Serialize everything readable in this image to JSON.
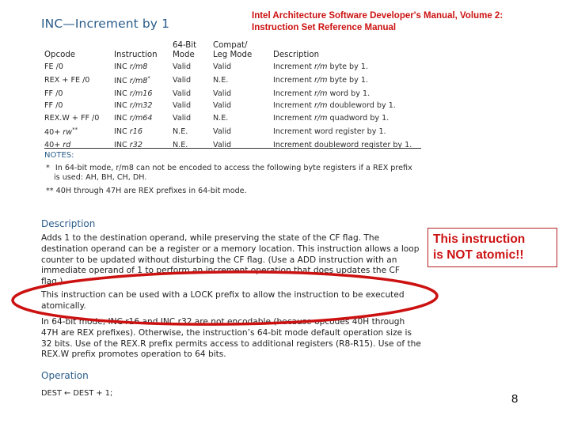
{
  "header": {
    "title": "INC—Increment by 1",
    "source_line1": "Intel Architecture Software Developer's Manual, Volume 2:",
    "source_line2": "Instruction Set Reference Manual"
  },
  "opcode_table": {
    "columns": [
      "Opcode",
      "Instruction",
      "64-Bit Mode",
      "Compat/ Leg Mode",
      "Description"
    ],
    "column_lines": [
      [
        "",
        "Opcode"
      ],
      [
        "",
        "Instruction"
      ],
      [
        "64-Bit",
        "Mode"
      ],
      [
        "Compat/",
        "Leg Mode"
      ],
      [
        "",
        "Description"
      ]
    ],
    "rows": [
      {
        "opcode": "FE /0",
        "instr_op": "INC",
        "instr_arg": "r/m8",
        "instr_sup": "",
        "mode64": "Valid",
        "compat": "Valid",
        "desc_pre": "Increment ",
        "desc_it": "r/m",
        "desc_post": " byte by 1."
      },
      {
        "opcode": "REX + FE /0",
        "instr_op": "INC",
        "instr_arg": "r/m8",
        "instr_sup": "*",
        "mode64": "Valid",
        "compat": "N.E.",
        "desc_pre": "Increment ",
        "desc_it": "r/m",
        "desc_post": " byte by 1."
      },
      {
        "opcode": "FF /0",
        "instr_op": "INC",
        "instr_arg": "r/m16",
        "instr_sup": "",
        "mode64": "Valid",
        "compat": "Valid",
        "desc_pre": "Increment ",
        "desc_it": "r/m",
        "desc_post": " word by 1."
      },
      {
        "opcode": "FF /0",
        "instr_op": "INC",
        "instr_arg": "r/m32",
        "instr_sup": "",
        "mode64": "Valid",
        "compat": "Valid",
        "desc_pre": "Increment ",
        "desc_it": "r/m",
        "desc_post": " doubleword by 1."
      },
      {
        "opcode": "REX.W + FF /0",
        "instr_op": "INC",
        "instr_arg": "r/m64",
        "instr_sup": "",
        "mode64": "Valid",
        "compat": "N.E.",
        "desc_pre": "Increment ",
        "desc_it": "r/m",
        "desc_post": " quadword by 1."
      },
      {
        "opcode": "40+ rw**",
        "instr_op": "INC",
        "instr_arg": "r16",
        "instr_sup": "",
        "mode64": "N.E.",
        "compat": "Valid",
        "desc_pre": "Increment word register by 1.",
        "desc_it": "",
        "desc_post": ""
      },
      {
        "opcode": "40+ rd",
        "instr_op": "INC",
        "instr_arg": "r32",
        "instr_sup": "",
        "mode64": "N.E.",
        "compat": "Valid",
        "desc_pre": "Increment doubleword register by 1.",
        "desc_it": "",
        "desc_post": ""
      }
    ]
  },
  "notes": {
    "heading": "NOTES:",
    "note1_marker": "*",
    "note1_line1": "In 64-bit mode, r/m8 can not be encoded to access the following byte registers if a REX prefix",
    "note1_line2": "is used: AH, BH, CH, DH.",
    "note2": "** 40H through 47H are REX prefixes in 64-bit mode."
  },
  "description": {
    "heading": "Description",
    "para1": "Adds 1 to the destination operand, while preserving the state of the CF flag. The destination operand can be a register or a memory location. This instruction allows a loop counter to be updated without disturbing the CF flag. (Use a ADD instruction with an immediate operand of 1 to perform an increment operation that does updates the CF flag.)",
    "para2": "This instruction can be used with a LOCK prefix to allow the instruction to be executed atomically.",
    "para3": "In 64-bit mode, INC r16 and INC r32 are not encodable (because opcodes 40H through 47H are REX prefixes). Otherwise, the instruction’s 64-bit mode default operation size is 32 bits. Use of the REX.R prefix permits access to additional registers (R8-R15). Use of the REX.W prefix promotes operation to 64 bits."
  },
  "operation": {
    "heading": "Operation",
    "code": "DEST ← DEST + 1;"
  },
  "annotation": {
    "callout_line1": "This instruction",
    "callout_line2": "is NOT atomic!!",
    "highlight_color": "#cc1111"
  },
  "page_number": "8"
}
